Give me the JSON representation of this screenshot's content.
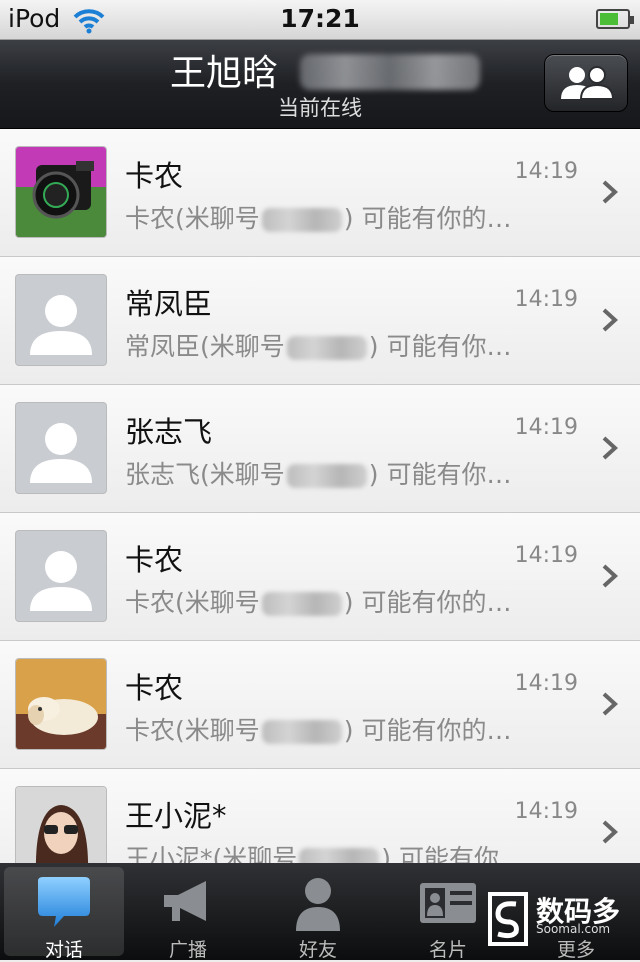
{
  "status_bar": {
    "carrier": "iPod",
    "time": "17:21"
  },
  "header": {
    "title": "王旭晗",
    "subtitle": "当前在线"
  },
  "conversations": [
    {
      "name": "卡农",
      "time": "14:19",
      "preview_prefix": "卡农(米聊号",
      "preview_suffix": ") 可能有你的…",
      "avatar": "camera-photo"
    },
    {
      "name": "常凤臣",
      "time": "14:19",
      "preview_prefix": "常凤臣(米聊号",
      "preview_suffix": ") 可能有你…",
      "avatar": "default"
    },
    {
      "name": "张志飞",
      "time": "14:19",
      "preview_prefix": "张志飞(米聊号",
      "preview_suffix": ") 可能有你…",
      "avatar": "default"
    },
    {
      "name": "卡农",
      "time": "14:19",
      "preview_prefix": "卡农(米聊号",
      "preview_suffix": ") 可能有你的…",
      "avatar": "default"
    },
    {
      "name": "卡农",
      "time": "14:19",
      "preview_prefix": "卡农(米聊号",
      "preview_suffix": ") 可能有你的…",
      "avatar": "dog-photo"
    },
    {
      "name": "王小泥*",
      "time": "14:19",
      "preview_prefix": "王小泥*(米聊号",
      "preview_suffix": ") 可能有你…",
      "avatar": "woman-photo"
    }
  ],
  "tabs": [
    {
      "label": "对话",
      "icon": "chat-bubble-icon",
      "active": true
    },
    {
      "label": "广播",
      "icon": "megaphone-icon",
      "active": false
    },
    {
      "label": "好友",
      "icon": "person-icon",
      "active": false
    },
    {
      "label": "名片",
      "icon": "card-icon",
      "active": false
    },
    {
      "label": "更多",
      "icon": "more-icon",
      "active": false
    }
  ],
  "watermark": {
    "text": "数码多",
    "sub": "Soomal.com"
  },
  "colors": {
    "accent": "#3aa0e8",
    "header": "#1e2024",
    "battery": "#4cbd37"
  }
}
